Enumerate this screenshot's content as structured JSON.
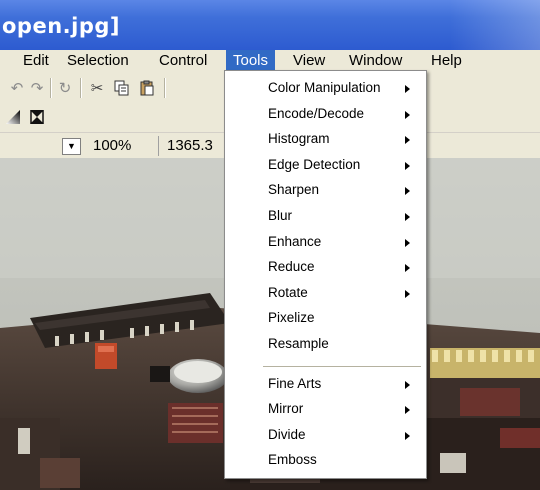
{
  "window": {
    "title": "open.jpg]"
  },
  "menubar": [
    {
      "label": "Edit",
      "active": false
    },
    {
      "label": "Selection",
      "active": false
    },
    {
      "label": "Control",
      "active": false
    },
    {
      "label": "Tools",
      "active": true
    },
    {
      "label": "View",
      "active": false
    },
    {
      "label": "Window",
      "active": false
    },
    {
      "label": "Help",
      "active": false
    }
  ],
  "toolbar_icons": [
    "undo-icon",
    "redo-icon",
    "rotate-icon",
    "cut-icon",
    "copy-icon",
    "paste-icon"
  ],
  "toolbar2_icons": [
    "gradient-tool-icon",
    "crop-tool-icon"
  ],
  "statusbar": {
    "zoom": "100%",
    "coords": "1365.3"
  },
  "tools_menu": {
    "items": [
      {
        "label": "Color Manipulation",
        "submenu": true
      },
      {
        "label": "Encode/Decode",
        "submenu": true
      },
      {
        "label": "Histogram",
        "submenu": true
      },
      {
        "label": "Edge Detection",
        "submenu": true
      },
      {
        "label": "Sharpen",
        "submenu": true
      },
      {
        "label": "Blur",
        "submenu": true
      },
      {
        "label": "Enhance",
        "submenu": true
      },
      {
        "label": "Reduce",
        "submenu": true
      },
      {
        "label": "Rotate",
        "submenu": true
      },
      {
        "label": "Pixelize",
        "submenu": false
      },
      {
        "label": "Resample",
        "submenu": false
      },
      {
        "separator": true
      },
      {
        "label": "Fine Arts",
        "submenu": true
      },
      {
        "label": "Mirror",
        "submenu": true
      },
      {
        "label": "Divide",
        "submenu": true
      },
      {
        "label": "Emboss",
        "submenu": false
      }
    ]
  },
  "colors": {
    "title_bar": "#2d5bd0",
    "menu_highlight": "#316ac5",
    "chrome": "#ece9d8"
  }
}
